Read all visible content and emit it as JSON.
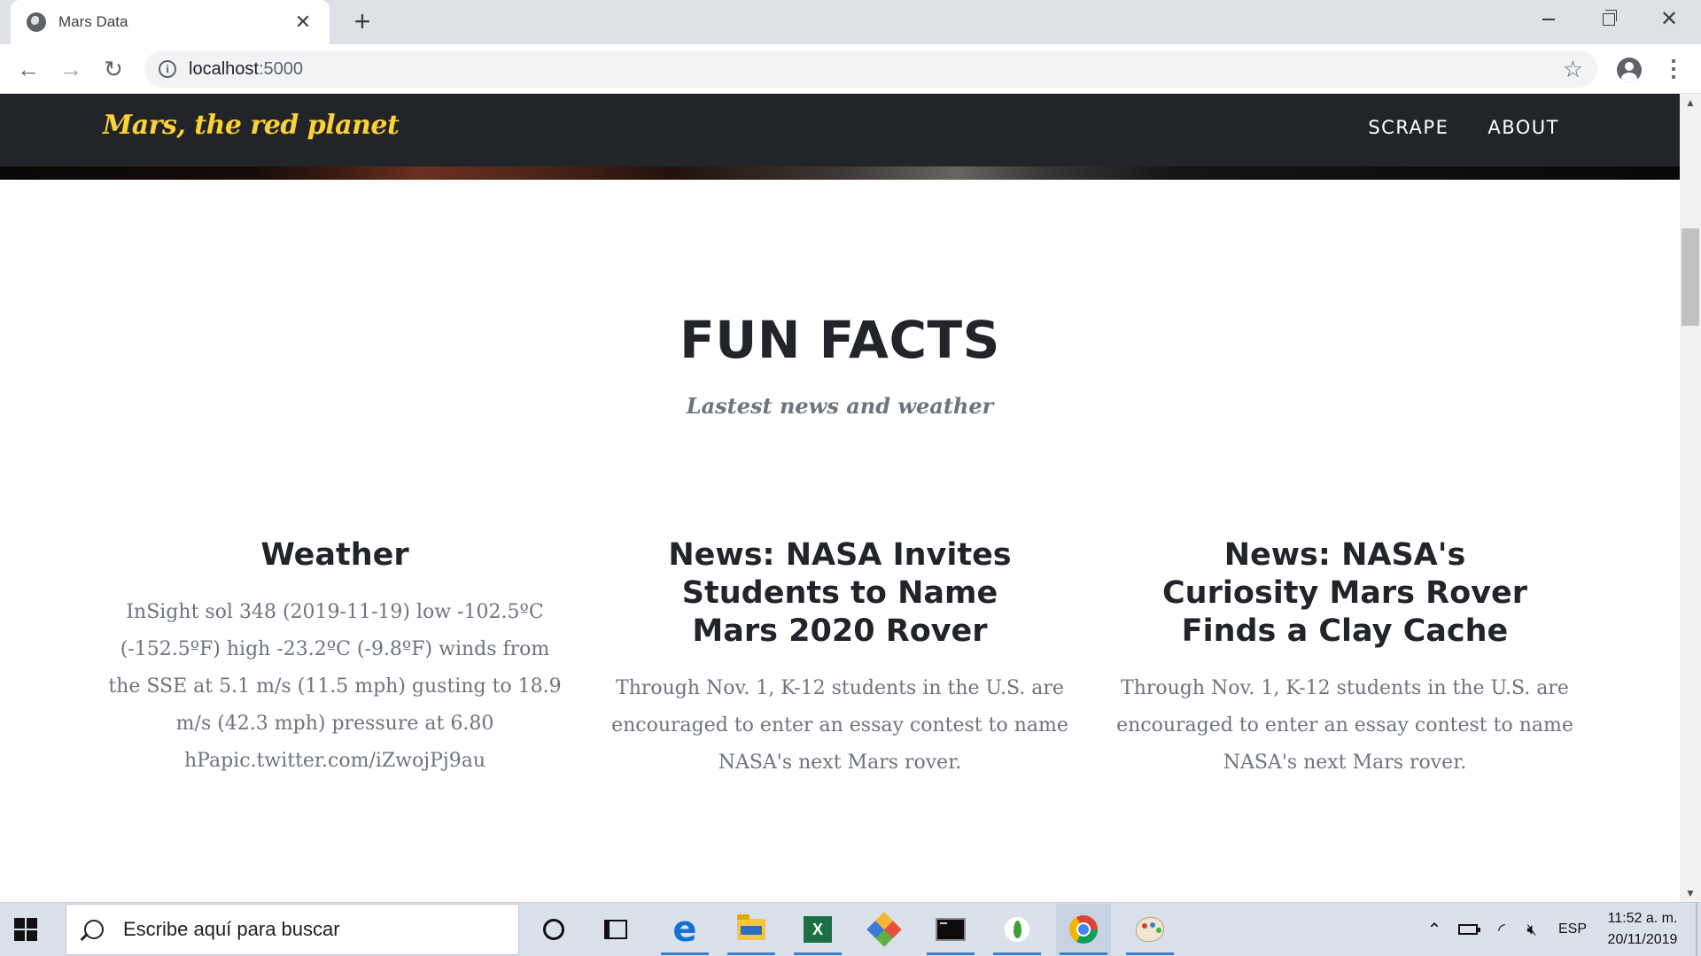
{
  "browser": {
    "tab_title": "Mars Data",
    "url_host": "localhost",
    "url_port": ":5000"
  },
  "site": {
    "brand": "Mars, the red planet",
    "nav": [
      "SCRAPE",
      "ABOUT"
    ]
  },
  "section": {
    "title": "FUN FACTS",
    "subtitle": "Lastest news and weather"
  },
  "cards": [
    {
      "heading": "Weather",
      "text": "InSight sol 348 (2019-11-19) low -102.5ºC (-152.5ºF) high -23.2ºC (-9.8ºF) winds from the SSE at 5.1 m/s (11.5 mph) gusting to 18.9 m/s (42.3 mph) pressure at 6.80 hPapic.twitter.com/iZwojPj9au"
    },
    {
      "heading": "News: NASA Invites Students to Name Mars 2020 Rover",
      "text": "Through Nov. 1, K-12 students in the U.S. are encouraged to enter an essay contest to name NASA's next Mars rover."
    },
    {
      "heading": "News: NASA's Curiosity Mars Rover Finds a Clay Cache",
      "text": "Through Nov. 1, K-12 students in the U.S. are encouraged to enter an essay contest to name NASA's next Mars rover."
    }
  ],
  "taskbar": {
    "search_placeholder": "Escribe aquí para buscar",
    "language": "ESP",
    "time": "11:52 a. m.",
    "date": "20/11/2019",
    "apps": [
      "cortana-icon",
      "task-view-icon",
      "edge-icon",
      "file-explorer-icon",
      "excel-icon",
      "git-icon",
      "terminal-icon",
      "mongodb-icon",
      "chrome-icon",
      "paint-icon"
    ]
  },
  "colors": {
    "navbar": "#212529",
    "brand": "#fed136",
    "heading": "#212529",
    "muted": "#6c757d",
    "taskbar": "#dae1ea"
  }
}
